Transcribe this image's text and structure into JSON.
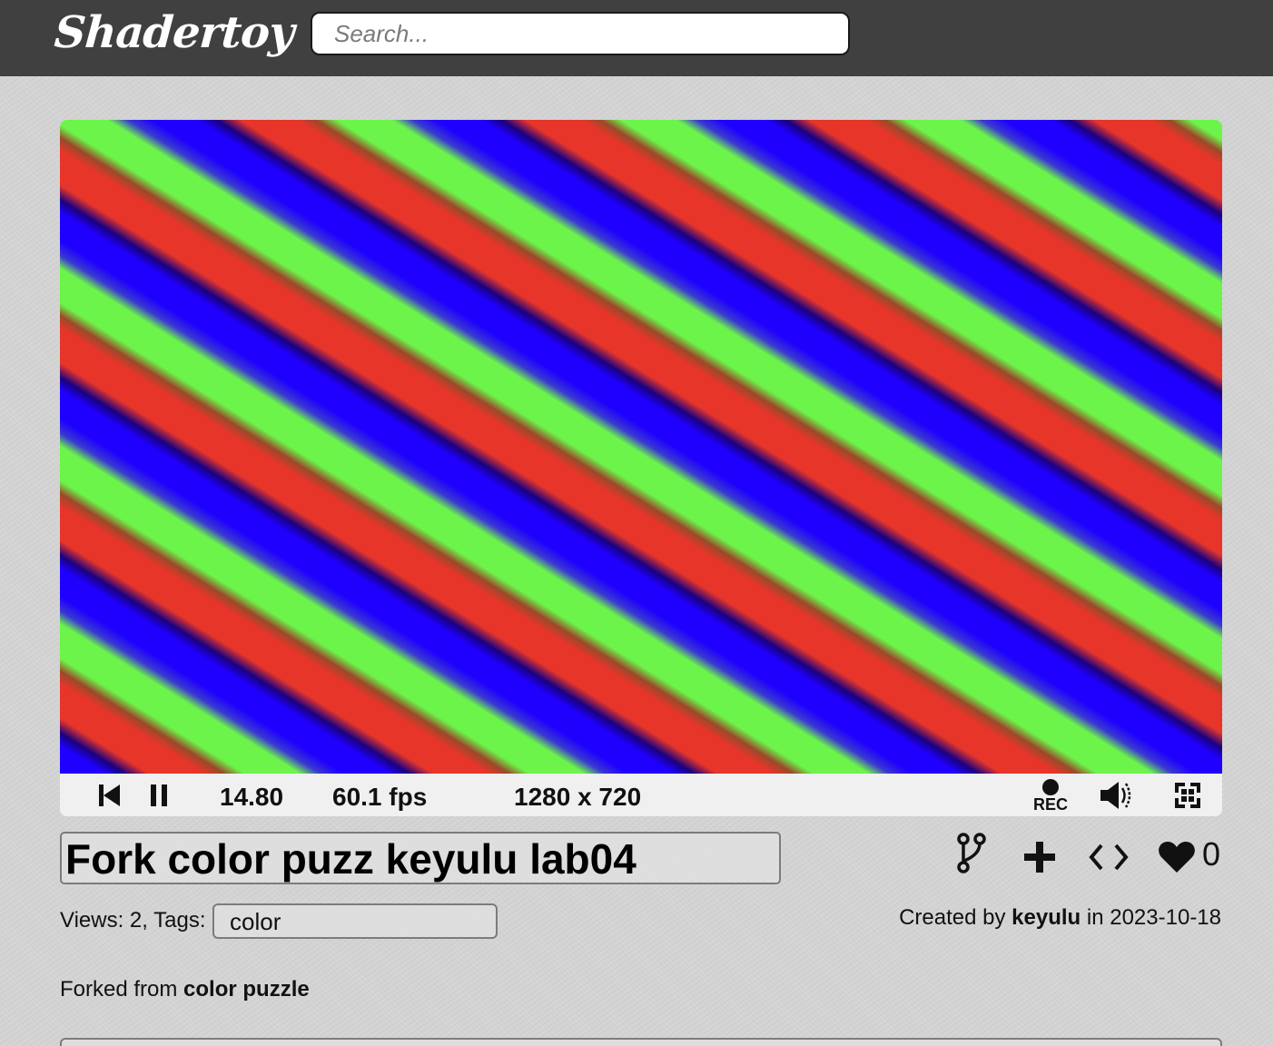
{
  "header": {
    "logo": "Shadertoy",
    "search_placeholder": "Search..."
  },
  "player": {
    "time": "14.80",
    "fps": "60.1 fps",
    "resolution": "1280 x 720",
    "rec_label": "REC",
    "stripe_colors": [
      "#1f00ff",
      "#e8352a",
      "#6cf44a"
    ]
  },
  "shader": {
    "title": "Fork color puzz keyulu lab04",
    "likes": "0",
    "views_label": "Views: 2, Tags:",
    "tags": "color",
    "created_by_prefix": "Created by",
    "author": "keyulu",
    "date_prefix": "in",
    "date": "2023-10-18",
    "forked_prefix": "Forked from",
    "forked_from": "color puzzle"
  }
}
